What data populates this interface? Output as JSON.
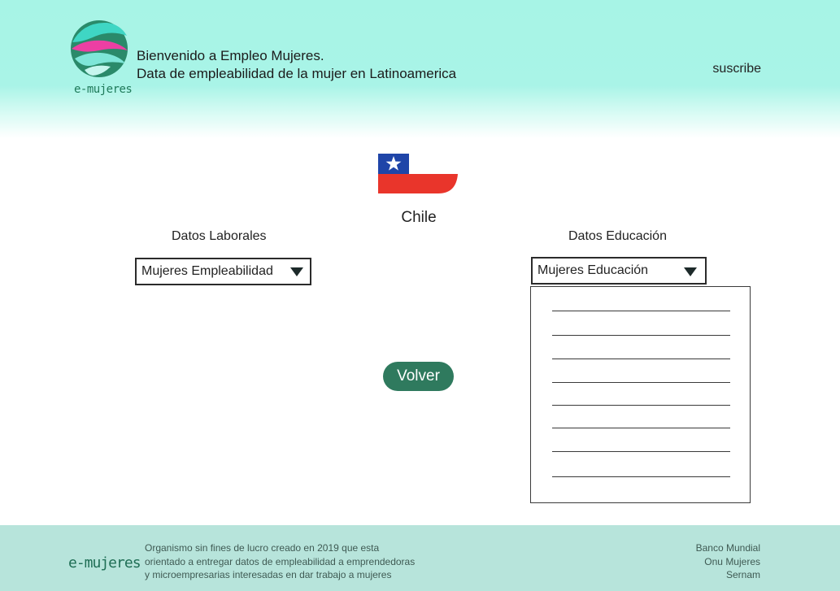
{
  "header": {
    "logo_text": "e-mujeres",
    "welcome_line1": "Bienvenido a  Empleo Mujeres.",
    "welcome_line2": "Data de empleabilidad de la mujer en Latinoamerica",
    "subscribe_label": "suscribe"
  },
  "country": {
    "name": "Chile",
    "flag_icon": "chile-flag-icon"
  },
  "datos_laborales": {
    "label": "Datos Laborales",
    "selected": "Mujeres Empleabilidad"
  },
  "datos_educacion": {
    "label": "Datos Educación",
    "selected": "Mujeres Educación",
    "options_placeholder_count": 8
  },
  "volver_button": {
    "label": "Volver"
  },
  "footer": {
    "logo_text": "e-mujeres",
    "description_line1": "Organismo sin fines de lucro creado en 2019 que esta",
    "description_line2": "orientado a entregar datos de empleabilidad a emprendedoras",
    "description_line3": "y microempresarias interesadas en dar trabajo a mujeres",
    "partners": [
      "Banco Mundial",
      "Onu Mujeres",
      "Sernam"
    ]
  },
  "colors": {
    "header_bg": "#a7f4e6",
    "footer_bg": "#b7e4db",
    "accent_green": "#2f7a5e",
    "flag_blue": "#1f45a8",
    "flag_red": "#e9352b"
  }
}
